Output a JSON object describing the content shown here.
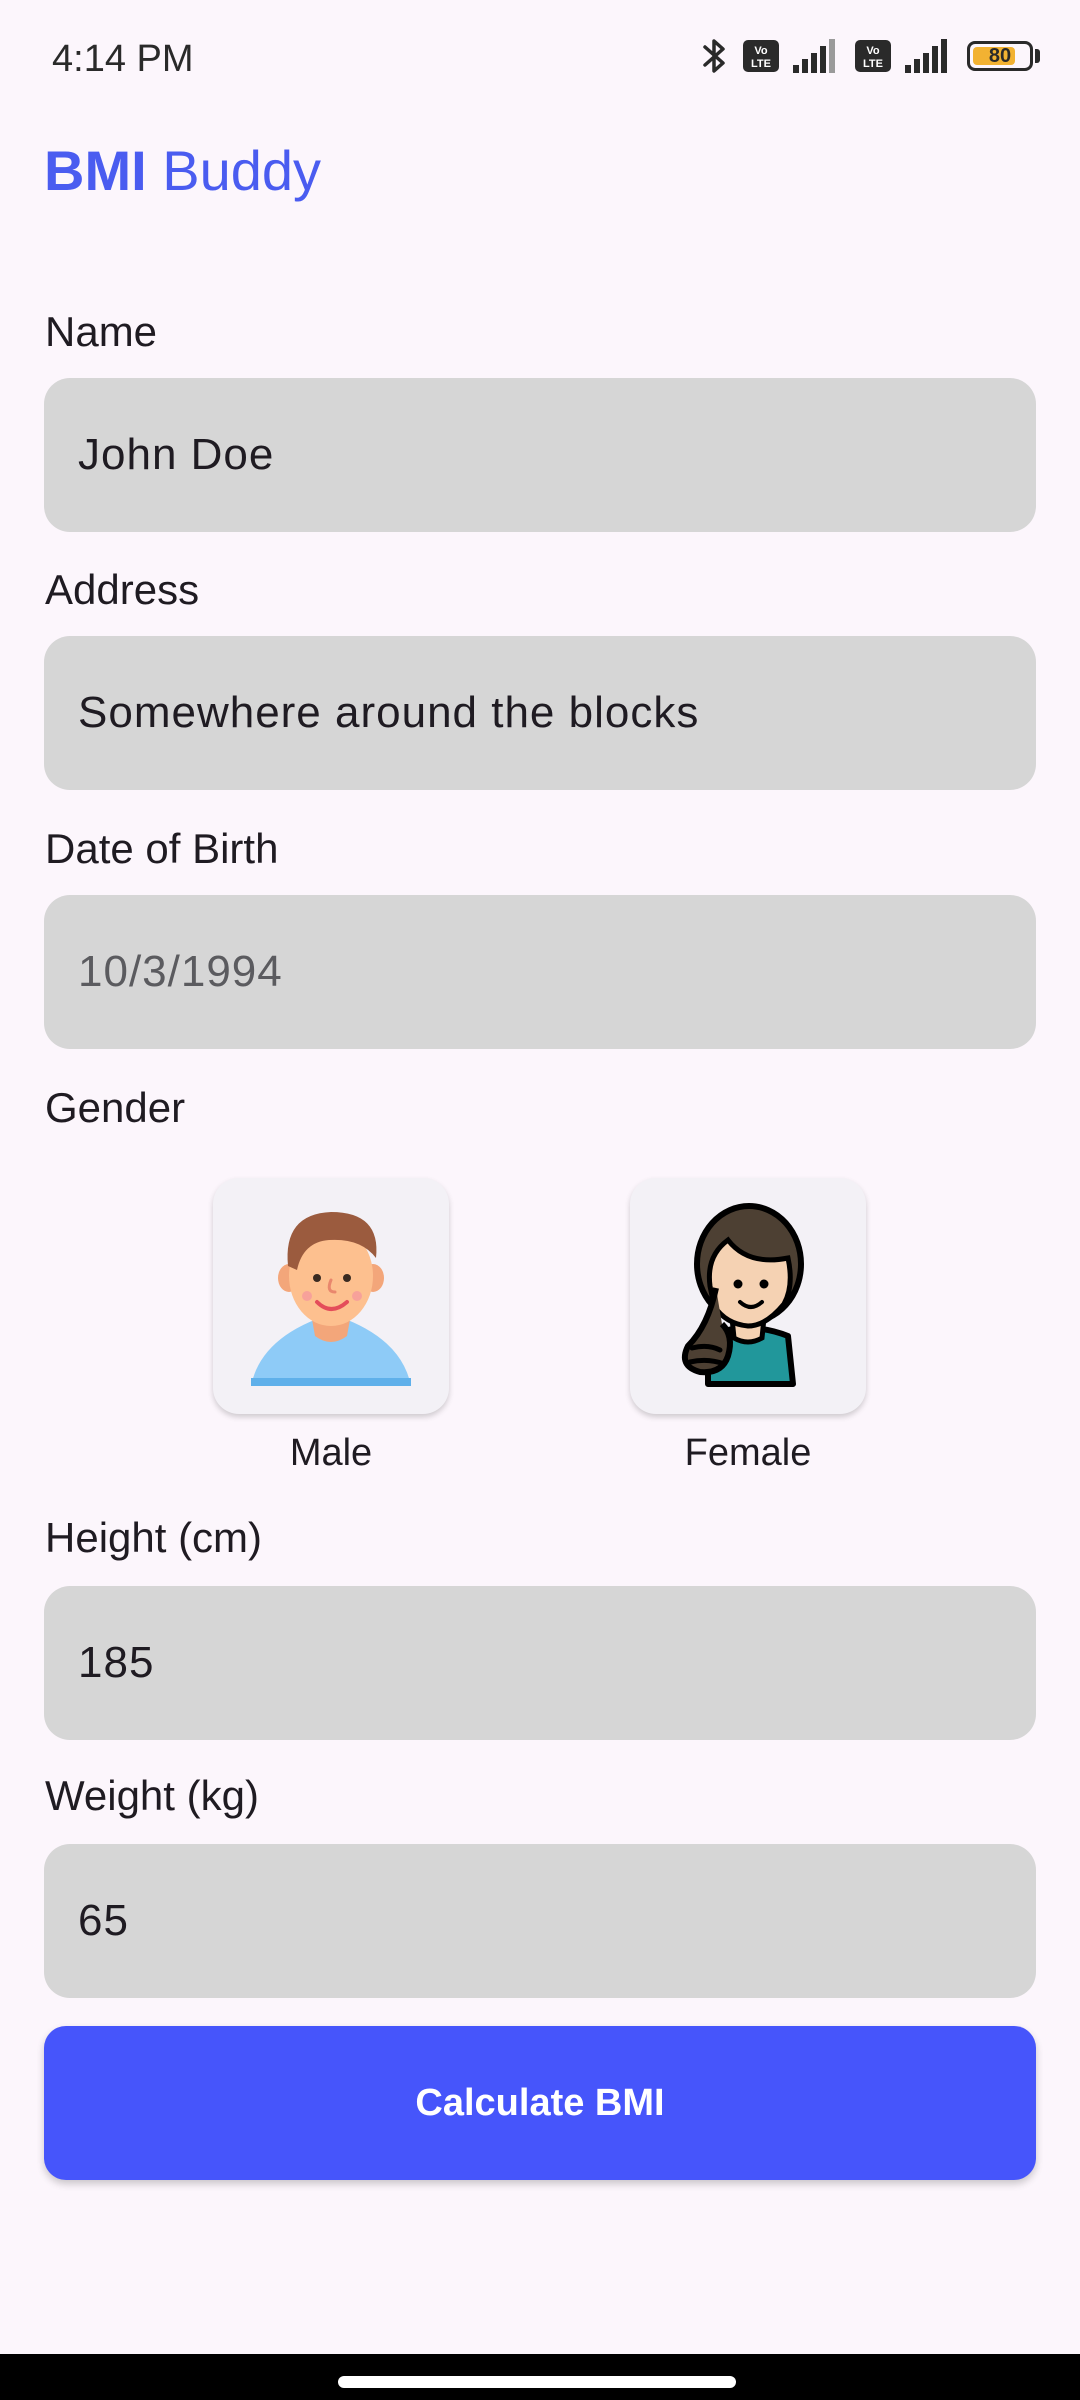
{
  "status_bar": {
    "time": "4:14 PM",
    "battery_level": "80",
    "battery_fraction": 0.8,
    "volte_label": "Vo LTE"
  },
  "app": {
    "title_bold": "BMI",
    "title_rest": "Buddy",
    "accent_color": "#4655fb"
  },
  "form": {
    "name": {
      "label": "Name",
      "value": "John Doe"
    },
    "address": {
      "label": "Address",
      "value": "Somewhere around the blocks"
    },
    "dob": {
      "label": "Date of Birth",
      "placeholder": "10/3/1994"
    },
    "gender": {
      "label": "Gender",
      "options": [
        {
          "label": "Male",
          "icon": "male-avatar-icon"
        },
        {
          "label": "Female",
          "icon": "female-avatar-icon"
        }
      ]
    },
    "height": {
      "label": "Height (cm)",
      "value": "185"
    },
    "weight": {
      "label": "Weight (kg)",
      "value": "65"
    },
    "submit_label": "Calculate BMI"
  }
}
